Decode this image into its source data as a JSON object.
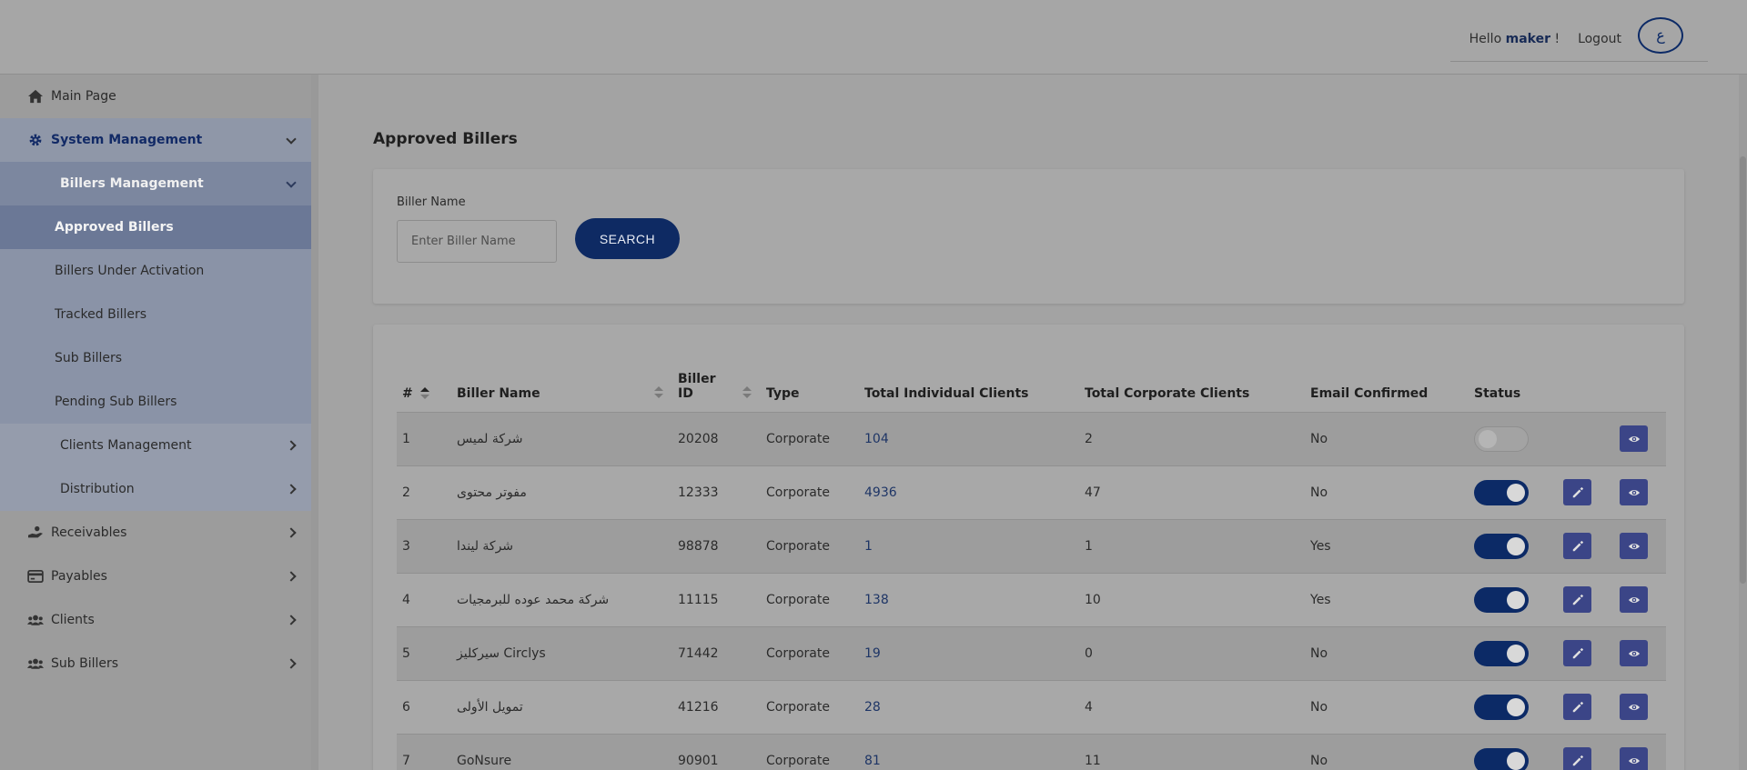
{
  "header": {
    "greeting": "Hello",
    "username": "maker",
    "greeting_suffix": "!",
    "logout_label": "Logout",
    "language_toggle": "ع"
  },
  "sidebar": {
    "items": [
      {
        "label": "Main Page",
        "icon": "home-icon"
      },
      {
        "label": "System Management",
        "icon": "gear-icon"
      },
      {
        "label": "Billers Management"
      },
      {
        "label": "Approved Billers"
      },
      {
        "label": "Billers Under Activation"
      },
      {
        "label": "Tracked Billers"
      },
      {
        "label": "Sub Billers"
      },
      {
        "label": "Pending Sub Billers"
      },
      {
        "label": "Clients Management"
      },
      {
        "label": "Distribution"
      },
      {
        "label": "Receivables",
        "icon": "hand-coin-icon"
      },
      {
        "label": "Payables",
        "icon": "credit-card-icon"
      },
      {
        "label": "Clients",
        "icon": "users-icon"
      },
      {
        "label": "Sub Billers",
        "icon": "users-icon"
      }
    ]
  },
  "page": {
    "title": "Approved Billers"
  },
  "search": {
    "field_label": "Biller Name",
    "placeholder": "Enter Biller Name",
    "button_label": "SEARCH"
  },
  "table": {
    "headers": [
      "#",
      "Biller Name",
      "Biller ID",
      "Type",
      "Total Individual Clients",
      "Total Corporate Clients",
      "Email Confirmed",
      "Status"
    ],
    "header_biller_id_line1": "Biller",
    "header_biller_id_line2": "ID",
    "rows": [
      {
        "num": "1",
        "name": "شركة لميس",
        "id": "20208",
        "type": "Corporate",
        "individual": "104",
        "corporate": "2",
        "email": "No",
        "status": "off",
        "editable": false
      },
      {
        "num": "2",
        "name": "مفوتر محتوى",
        "id": "12333",
        "type": "Corporate",
        "individual": "4936",
        "corporate": "47",
        "email": "No",
        "status": "on",
        "editable": true
      },
      {
        "num": "3",
        "name": "شركة ليندا",
        "id": "98878",
        "type": "Corporate",
        "individual": "1",
        "corporate": "1",
        "email": "Yes",
        "status": "on",
        "editable": true
      },
      {
        "num": "4",
        "name": "شركة محمد عوده للبرمجيات",
        "id": "11115",
        "type": "Corporate",
        "individual": "138",
        "corporate": "10",
        "email": "Yes",
        "status": "on",
        "editable": true
      },
      {
        "num": "5",
        "name": "سيركليز Circlys",
        "id": "71442",
        "type": "Corporate",
        "individual": "19",
        "corporate": "0",
        "email": "No",
        "status": "on",
        "editable": true
      },
      {
        "num": "6",
        "name": "تمويل الأولى",
        "id": "41216",
        "type": "Corporate",
        "individual": "28",
        "corporate": "4",
        "email": "No",
        "status": "on",
        "editable": true
      },
      {
        "num": "7",
        "name": "GoNsure",
        "id": "90901",
        "type": "Corporate",
        "individual": "81",
        "corporate": "11",
        "email": "No",
        "status": "on",
        "editable": true
      }
    ]
  },
  "colors": {
    "primary": "#0c2a66",
    "action_button": "#3b4587"
  }
}
